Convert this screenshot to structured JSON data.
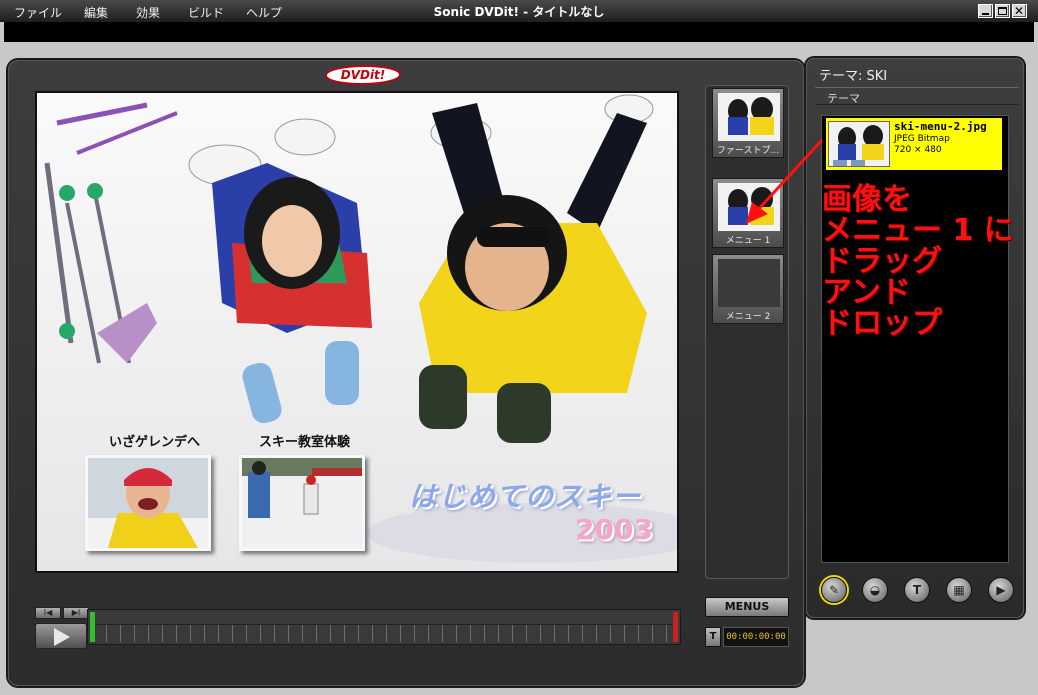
{
  "window": {
    "title": "Sonic DVDit! - タイトルなし",
    "menu": [
      "ファイル",
      "編集",
      "効果",
      "ビルド",
      "ヘルプ"
    ]
  },
  "logo": "DVDit!",
  "preview": {
    "thumb_labels": [
      "いざゲレンデへ",
      "スキー教室体験"
    ],
    "title": "はじめてのスキー",
    "year": "2003"
  },
  "menu_strip": {
    "items": [
      {
        "label": "ファーストプ..."
      },
      {
        "label": "メニュー 1"
      },
      {
        "label": "メニュー 2"
      }
    ]
  },
  "controls": {
    "menus_button": "MENUS",
    "t_button": "T",
    "timecode": "00:00:00:00",
    "timeline_small_buttons": [
      "I◀",
      "▶I"
    ]
  },
  "theme_panel": {
    "header": "テーマ: SKI",
    "sub": "テーマ",
    "item": {
      "filename": "ski-menu-2.jpg",
      "type": "JPEG Bitmap",
      "size": "720 × 480"
    },
    "tools": [
      {
        "icon": "brush-icon",
        "glyph": "✎"
      },
      {
        "icon": "button-icon",
        "glyph": "◒"
      },
      {
        "icon": "text-icon",
        "glyph": "T"
      },
      {
        "icon": "film-icon",
        "glyph": "▦"
      },
      {
        "icon": "play-icon",
        "glyph": "▶"
      }
    ]
  },
  "annotation": {
    "lines": [
      "画像を",
      "メニュー 1 に",
      "ドラッグ",
      "アンド",
      "ドロップ"
    ],
    "color": "#ff1010"
  },
  "colors": {
    "highlight": "#ffff00",
    "timecode": "#e3c230"
  }
}
